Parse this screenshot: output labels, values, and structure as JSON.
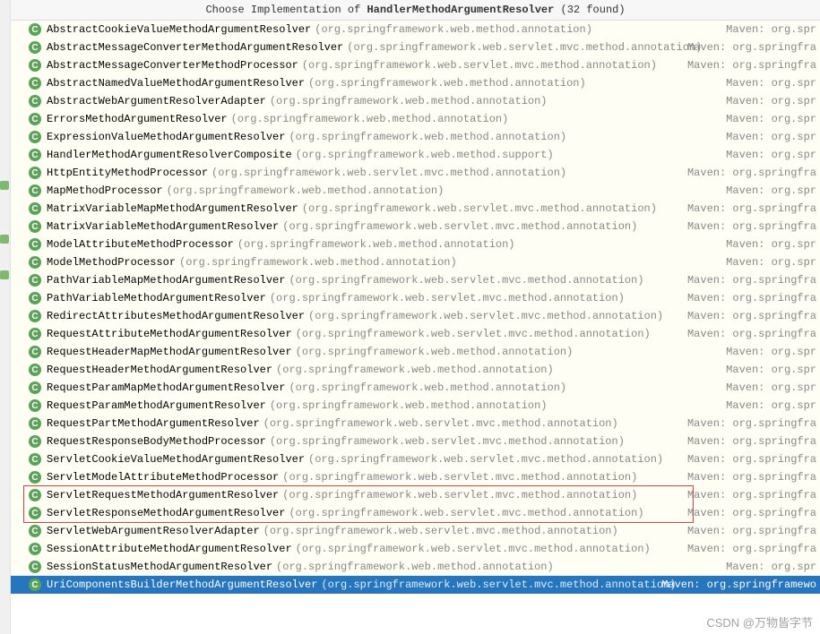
{
  "header": {
    "prefix": "Choose Implementation of ",
    "bold": "HandlerMethodArgumentResolver",
    "suffix": " (32 found)"
  },
  "source_prefix": "Maven: org.spr",
  "source_prefix_long": "Maven: org.springfra",
  "source_prefix_full": "Maven: org.springframewo",
  "items": [
    {
      "name": "AbstractCookieValueMethodArgumentResolver",
      "pkg": "(org.springframework.web.method.annotation)",
      "src": "Maven: org.spr"
    },
    {
      "name": "AbstractMessageConverterMethodArgumentResolver",
      "pkg": "(org.springframework.web.servlet.mvc.method.annotation)",
      "src": "Maven: org.springfra"
    },
    {
      "name": "AbstractMessageConverterMethodProcessor",
      "pkg": "(org.springframework.web.servlet.mvc.method.annotation)",
      "src": "Maven: org.springfra"
    },
    {
      "name": "AbstractNamedValueMethodArgumentResolver",
      "pkg": "(org.springframework.web.method.annotation)",
      "src": "Maven: org.spr"
    },
    {
      "name": "AbstractWebArgumentResolverAdapter",
      "pkg": "(org.springframework.web.method.annotation)",
      "src": "Maven: org.spr"
    },
    {
      "name": "ErrorsMethodArgumentResolver",
      "pkg": "(org.springframework.web.method.annotation)",
      "src": "Maven: org.spr"
    },
    {
      "name": "ExpressionValueMethodArgumentResolver",
      "pkg": "(org.springframework.web.method.annotation)",
      "src": "Maven: org.spr"
    },
    {
      "name": "HandlerMethodArgumentResolverComposite",
      "pkg": "(org.springframework.web.method.support)",
      "src": "Maven: org.spr"
    },
    {
      "name": "HttpEntityMethodProcessor",
      "pkg": "(org.springframework.web.servlet.mvc.method.annotation)",
      "src": "Maven: org.springfra"
    },
    {
      "name": "MapMethodProcessor",
      "pkg": "(org.springframework.web.method.annotation)",
      "src": "Maven: org.spr"
    },
    {
      "name": "MatrixVariableMapMethodArgumentResolver",
      "pkg": "(org.springframework.web.servlet.mvc.method.annotation)",
      "src": "Maven: org.springfra"
    },
    {
      "name": "MatrixVariableMethodArgumentResolver",
      "pkg": "(org.springframework.web.servlet.mvc.method.annotation)",
      "src": "Maven: org.springfra"
    },
    {
      "name": "ModelAttributeMethodProcessor",
      "pkg": "(org.springframework.web.method.annotation)",
      "src": "Maven: org.spr"
    },
    {
      "name": "ModelMethodProcessor",
      "pkg": "(org.springframework.web.method.annotation)",
      "src": "Maven: org.spr"
    },
    {
      "name": "PathVariableMapMethodArgumentResolver",
      "pkg": "(org.springframework.web.servlet.mvc.method.annotation)",
      "src": "Maven: org.springfra"
    },
    {
      "name": "PathVariableMethodArgumentResolver",
      "pkg": "(org.springframework.web.servlet.mvc.method.annotation)",
      "src": "Maven: org.springfra"
    },
    {
      "name": "RedirectAttributesMethodArgumentResolver",
      "pkg": "(org.springframework.web.servlet.mvc.method.annotation)",
      "src": "Maven: org.springfra"
    },
    {
      "name": "RequestAttributeMethodArgumentResolver",
      "pkg": "(org.springframework.web.servlet.mvc.method.annotation)",
      "src": "Maven: org.springfra"
    },
    {
      "name": "RequestHeaderMapMethodArgumentResolver",
      "pkg": "(org.springframework.web.method.annotation)",
      "src": "Maven: org.spr"
    },
    {
      "name": "RequestHeaderMethodArgumentResolver",
      "pkg": "(org.springframework.web.method.annotation)",
      "src": "Maven: org.spr"
    },
    {
      "name": "RequestParamMapMethodArgumentResolver",
      "pkg": "(org.springframework.web.method.annotation)",
      "src": "Maven: org.spr"
    },
    {
      "name": "RequestParamMethodArgumentResolver",
      "pkg": "(org.springframework.web.method.annotation)",
      "src": "Maven: org.spr"
    },
    {
      "name": "RequestPartMethodArgumentResolver",
      "pkg": "(org.springframework.web.servlet.mvc.method.annotation)",
      "src": "Maven: org.springfra"
    },
    {
      "name": "RequestResponseBodyMethodProcessor",
      "pkg": "(org.springframework.web.servlet.mvc.method.annotation)",
      "src": "Maven: org.springfra"
    },
    {
      "name": "ServletCookieValueMethodArgumentResolver",
      "pkg": "(org.springframework.web.servlet.mvc.method.annotation)",
      "src": "Maven: org.springfra"
    },
    {
      "name": "ServletModelAttributeMethodProcessor",
      "pkg": "(org.springframework.web.servlet.mvc.method.annotation)",
      "src": "Maven: org.springfra"
    },
    {
      "name": "ServletRequestMethodArgumentResolver",
      "pkg": "(org.springframework.web.servlet.mvc.method.annotation)",
      "src": "Maven: org.springfra",
      "boxed": true
    },
    {
      "name": "ServletResponseMethodArgumentResolver",
      "pkg": "(org.springframework.web.servlet.mvc.method.annotation)",
      "src": "Maven: org.springfra",
      "boxed": true
    },
    {
      "name": "ServletWebArgumentResolverAdapter",
      "pkg": "(org.springframework.web.servlet.mvc.method.annotation)",
      "src": "Maven: org.springfra"
    },
    {
      "name": "SessionAttributeMethodArgumentResolver",
      "pkg": "(org.springframework.web.servlet.mvc.method.annotation)",
      "src": "Maven: org.springfra"
    },
    {
      "name": "SessionStatusMethodArgumentResolver",
      "pkg": "(org.springframework.web.method.annotation)",
      "src": "Maven: org.spr"
    },
    {
      "name": "UriComponentsBuilderMethodArgumentResolver",
      "pkg": "(org.springframework.web.servlet.mvc.method.annotation)",
      "src": "Maven: org.springframewo",
      "selected": true
    }
  ],
  "watermark": "CSDN @万物皆字节"
}
